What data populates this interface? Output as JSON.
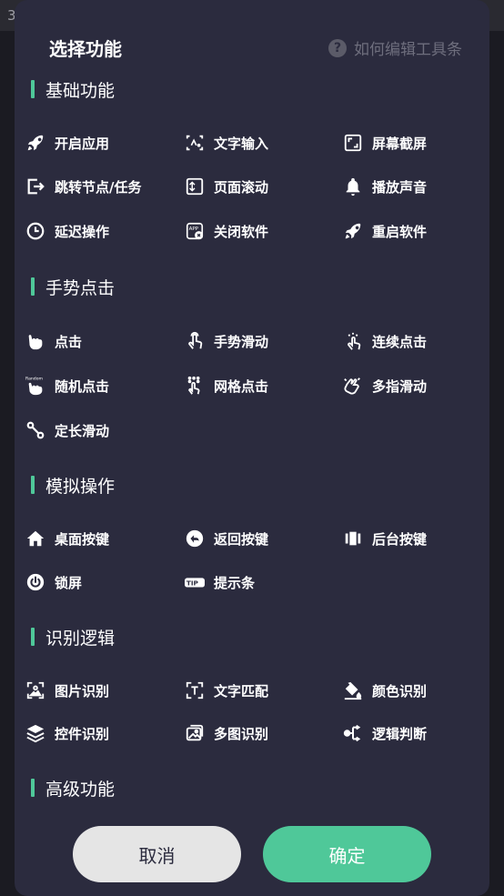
{
  "background": {
    "left_text": "3",
    "right_text": ""
  },
  "dialog": {
    "title": "选择功能",
    "help_text": "如何编辑工具条",
    "cancel_label": "取消",
    "confirm_label": "确定"
  },
  "colors": {
    "accent": "#4fc899",
    "panel": "#2b2b3e",
    "cancel_bg": "#e5e5e5"
  },
  "sections": [
    {
      "title": "基础功能",
      "items": [
        {
          "label": "开启应用",
          "icon": "rocket-icon"
        },
        {
          "label": "文字输入",
          "icon": "text-input-icon"
        },
        {
          "label": "屏幕截屏",
          "icon": "screenshot-icon"
        },
        {
          "label": "跳转节点/任务",
          "icon": "jump-node-icon"
        },
        {
          "label": "页面滚动",
          "icon": "page-scroll-icon"
        },
        {
          "label": "播放声音",
          "icon": "bell-icon"
        },
        {
          "label": "延迟操作",
          "icon": "clock-icon"
        },
        {
          "label": "关闭软件",
          "icon": "close-app-icon"
        },
        {
          "label": "重启软件",
          "icon": "restart-rocket-icon"
        }
      ]
    },
    {
      "title": "手势点击",
      "items": [
        {
          "label": "点击",
          "icon": "tap-icon"
        },
        {
          "label": "手势滑动",
          "icon": "swipe-icon"
        },
        {
          "label": "连续点击",
          "icon": "multi-tap-icon"
        },
        {
          "label": "随机点击",
          "icon": "random-tap-icon",
          "badge": "Random"
        },
        {
          "label": "网格点击",
          "icon": "grid-tap-icon"
        },
        {
          "label": "多指滑动",
          "icon": "multi-finger-icon"
        },
        {
          "label": "定长滑动",
          "icon": "fixed-swipe-icon"
        }
      ]
    },
    {
      "title": "模拟操作",
      "items": [
        {
          "label": "桌面按键",
          "icon": "home-icon"
        },
        {
          "label": "返回按键",
          "icon": "back-icon"
        },
        {
          "label": "后台按键",
          "icon": "recents-icon"
        },
        {
          "label": "锁屏",
          "icon": "power-icon"
        },
        {
          "label": "提示条",
          "icon": "tip-icon",
          "badge": "TIP"
        }
      ]
    },
    {
      "title": "识别逻辑",
      "items": [
        {
          "label": "图片识别",
          "icon": "image-recognize-icon"
        },
        {
          "label": "文字匹配",
          "icon": "text-match-icon"
        },
        {
          "label": "颜色识别",
          "icon": "paint-bucket-icon"
        },
        {
          "label": "控件识别",
          "icon": "layers-icon"
        },
        {
          "label": "多图识别",
          "icon": "multi-image-icon"
        },
        {
          "label": "逻辑判断",
          "icon": "logic-branch-icon"
        }
      ]
    },
    {
      "title": "高级功能",
      "items": []
    }
  ]
}
